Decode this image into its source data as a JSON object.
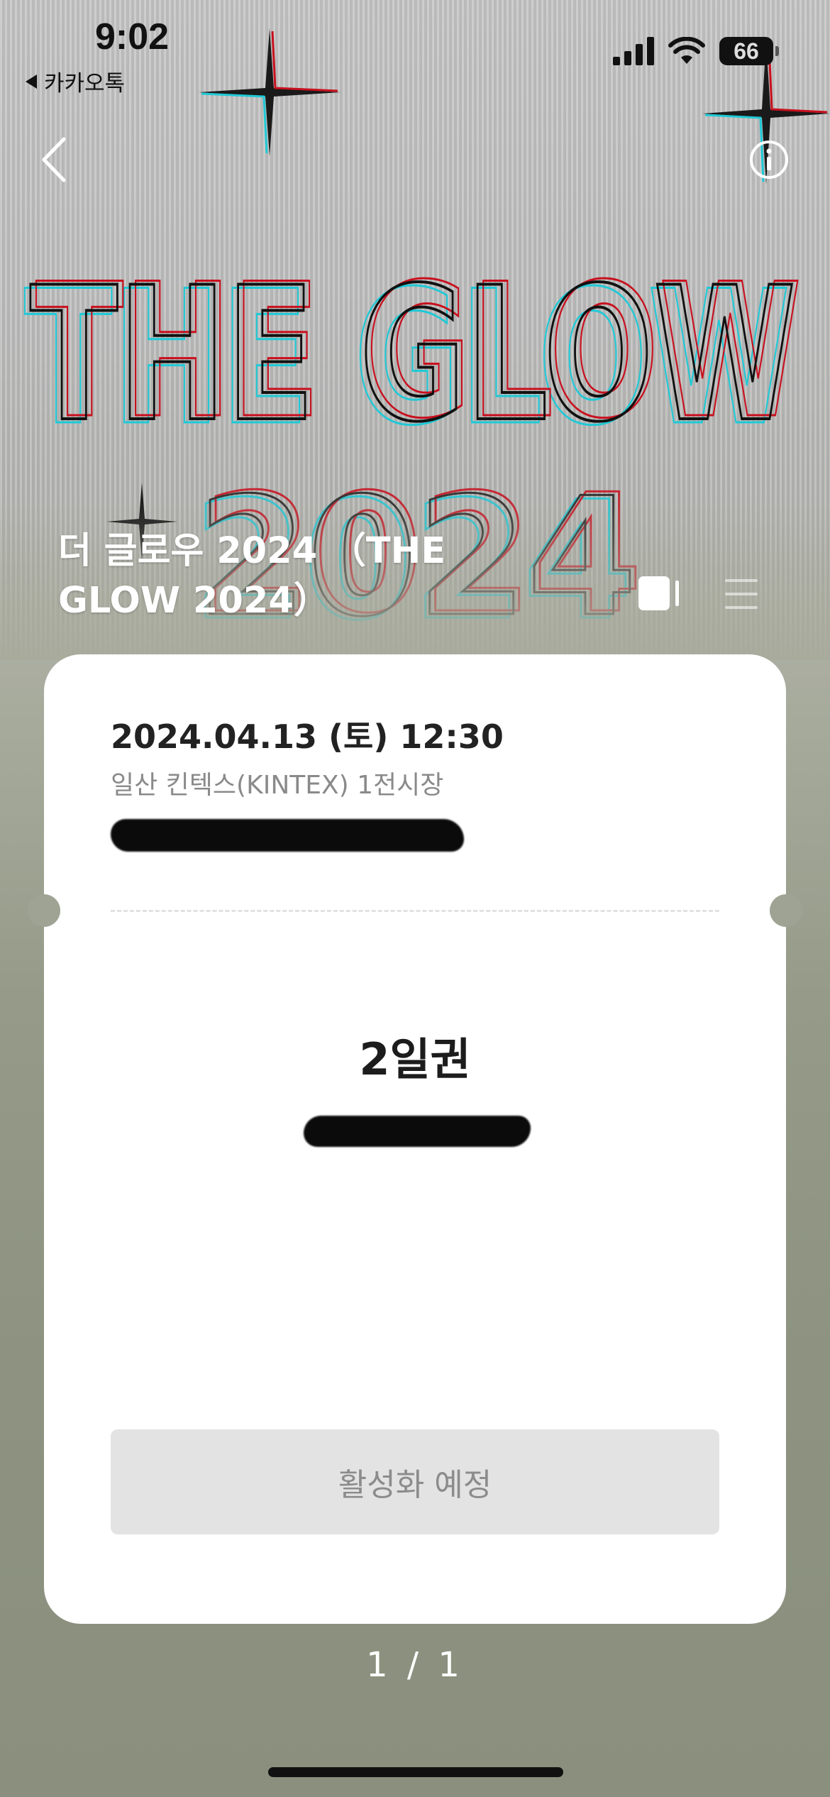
{
  "status_bar": {
    "time": "9:02",
    "back_app_label": "카카오톡",
    "battery_level": "66",
    "icons": [
      "cellular-signal-icon",
      "wifi-icon",
      "battery-icon"
    ]
  },
  "nav": {
    "back_icon": "chevron-left-icon",
    "info_icon": "info-circle-icon"
  },
  "poster": {
    "headline": "THE GLOW",
    "year": "2024"
  },
  "event": {
    "title": "더 글로우 2024 （THE GLOW 2024）"
  },
  "view_toggles": {
    "card_icon": "card-view-icon",
    "list_icon": "list-view-icon"
  },
  "ticket": {
    "date": "2024.04.13 (토) 12:30",
    "venue": "일산 킨텍스(KINTEX) 1전시장",
    "type": "2일권",
    "action_label": "활성화 예정"
  },
  "pager": {
    "text": "1 / 1"
  },
  "colors": {
    "background": "#8e9381",
    "ticket": "#ffffff",
    "button_disabled": "#e3e3e3",
    "poster_red": "#c8101e",
    "poster_cyan": "#1fc9d6"
  }
}
